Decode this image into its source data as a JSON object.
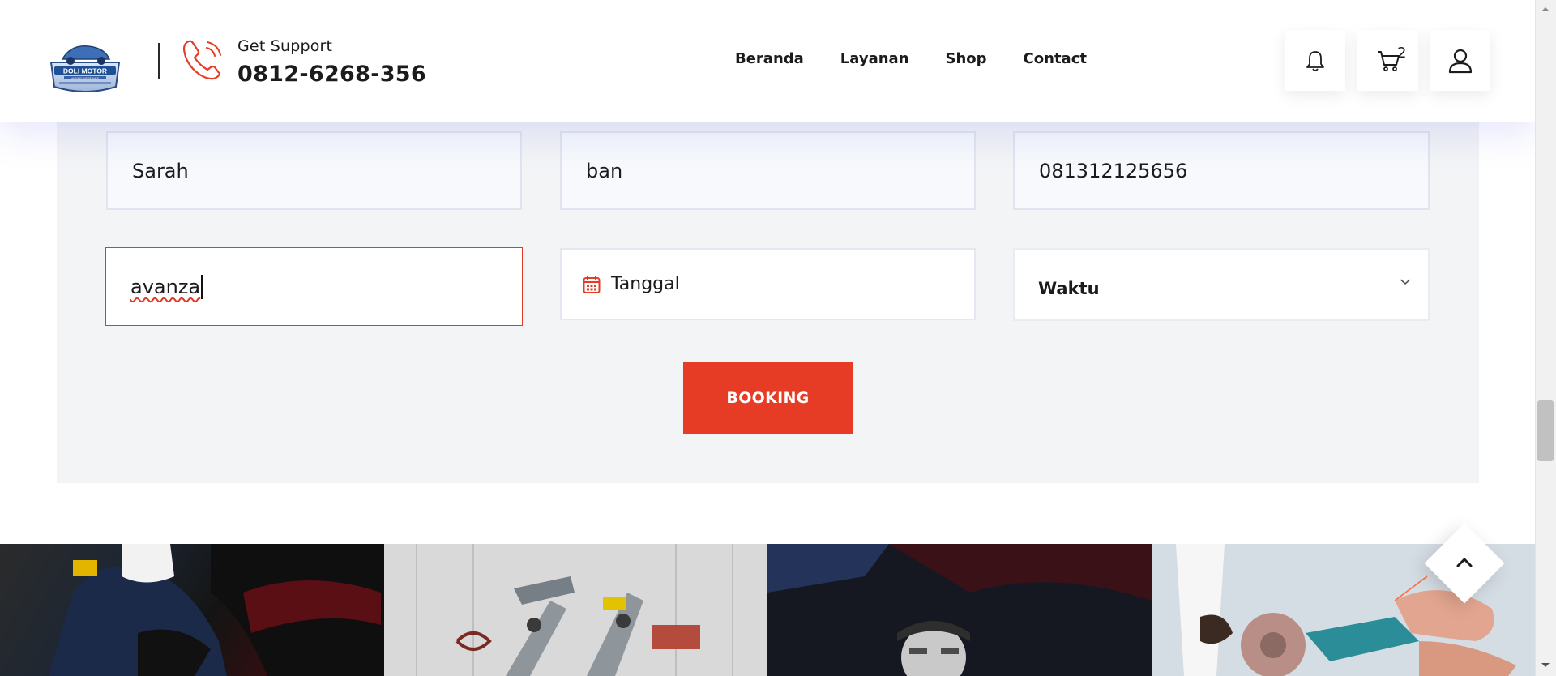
{
  "header": {
    "logo_text": "DOLI MOTOR",
    "logo_subtext": "AUTOMOTIVE SERVICE",
    "support_label": "Get Support",
    "support_phone": "0812-6268-356",
    "nav": [
      "Beranda",
      "Layanan",
      "Shop",
      "Contact"
    ],
    "cart_count": "2"
  },
  "form": {
    "name_value": "Sarah",
    "service_value": "ban",
    "phone_value": "081312125656",
    "car_value": "avanza",
    "date_placeholder": "Tanggal",
    "time_selected": "Waktu",
    "booking_label": "BOOKING"
  },
  "colors": {
    "accent": "#e63c26",
    "field_bg": "#f7f9fc",
    "section_bg": "#f2f4f6",
    "text": "#1b1b1b"
  },
  "icons": [
    "phone-icon",
    "bell-icon",
    "cart-icon",
    "user-icon",
    "calendar-icon",
    "chevron-down-icon",
    "arrow-up-icon"
  ]
}
